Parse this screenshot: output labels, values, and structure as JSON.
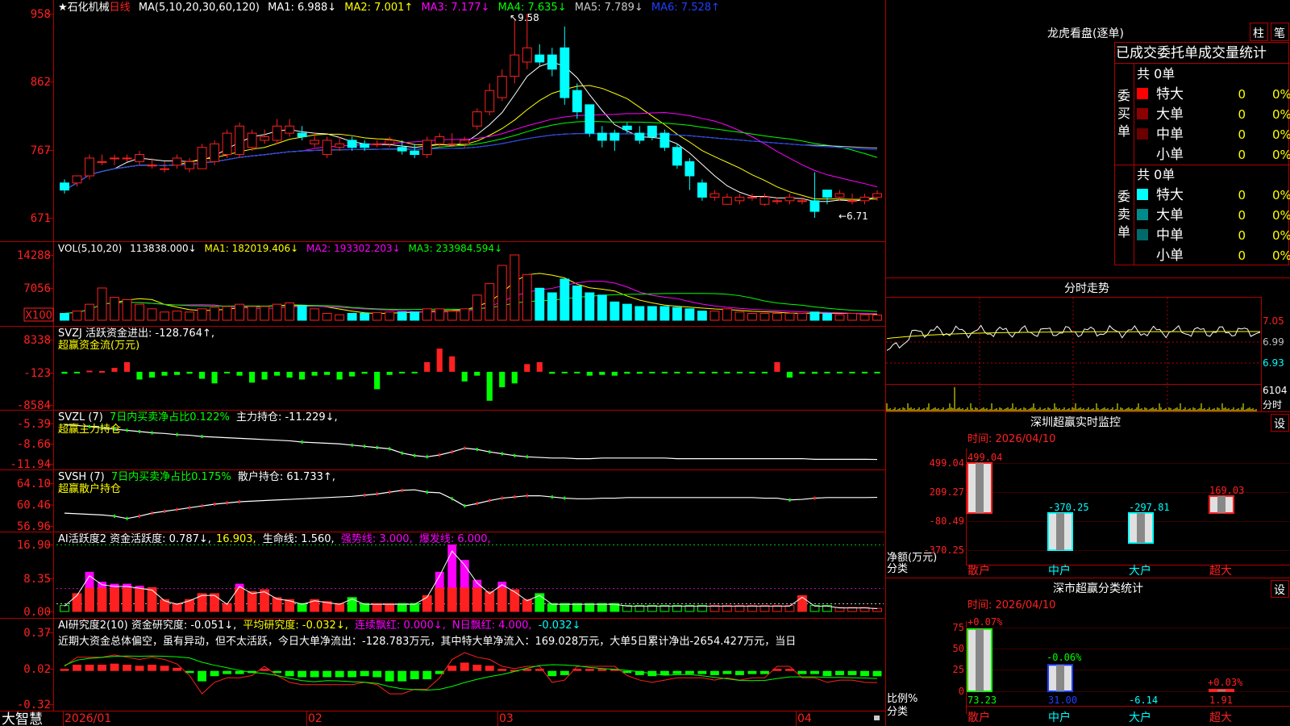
{
  "stock_title": "★石化机械",
  "period": "日线",
  "colors": {
    "up": "#ff2020",
    "down": "#00ffff",
    "grid": "#b00000",
    "ma1": "#ffffff",
    "ma2": "#ffff00",
    "ma3": "#ff00ff",
    "ma4": "#00ff00",
    "ma5": "#c8c8c8",
    "ma6": "#2040ff",
    "green": "#00ff00",
    "yellow": "#ffff00",
    "magenta": "#ff00ff"
  },
  "price_panel": {
    "header": [
      "MA(5,10,20,30,60,120)",
      "MA1: 6.988↓",
      "MA2: 7.001↑",
      "MA3: 7.177↓",
      "MA4: 7.635↓",
      "MA5: 7.789↓",
      "MA6: 7.528↑"
    ],
    "y_labels": [
      "958",
      "862",
      "767",
      "671"
    ],
    "high_note": "9.58",
    "low_note": "←6.71"
  },
  "vol_panel": {
    "header": [
      "VOL(5,10,20)",
      "113838.000↓",
      "MA1: 182019.406↓",
      "MA2: 193302.203↓",
      "MA3: 233984.594↓"
    ],
    "y_labels": [
      "14288",
      "7056",
      "X100"
    ]
  },
  "svzj_panel": {
    "header": "SVZJ  活跃资金进出: -128.764↑,",
    "subtitle": "超赢资金流(万元)",
    "y_labels": [
      "8338",
      "-123",
      "-8584"
    ]
  },
  "svzl_panel": {
    "header_a": "SVZL (7)",
    "header_b": "7日内买卖净占比0.122%",
    "header_c": "主力持仓: -11.229↓,",
    "subtitle": "超赢主力持仓",
    "y_labels": [
      "-5.39",
      "-8.66",
      "-11.94"
    ]
  },
  "svsh_panel": {
    "header_a": "SVSH (7)",
    "header_b": "7日内买卖净占比0.175%",
    "header_c": "散户持仓: 61.733↑,",
    "subtitle": "超赢散户持仓",
    "y_labels": [
      "64.10",
      "60.46",
      "56.96"
    ]
  },
  "ai1_panel": {
    "header": [
      "AI活跃度2 资金活跃度: 0.787↓,",
      "16.903,",
      "生命线: 1.560,",
      "强势线: 3.000,",
      "爆发线: 6.000,"
    ],
    "y_labels": [
      "16.90",
      "8.35",
      "0.00"
    ]
  },
  "ai2_panel": {
    "header": [
      "AI研究度2(10) 资金研究度: -0.051↓,",
      "平均研究度: -0.032↓,",
      "连续飘红: 0.000↓,",
      "N日飘红: 4.000,",
      "-0.032↓"
    ],
    "note": "近期大资金总体偏空，虽有异动，但不太活跃，今日大单净流出：-128.783万元，其中特大单净流入：169.028万元，大单5日累计净出-2654.427万元，当日",
    "y_labels": [
      "0.37",
      "0.02",
      "-0.32"
    ]
  },
  "x_axis": {
    "logo": "大智慧",
    "labels": [
      "2026/01",
      "02",
      "03",
      "04"
    ]
  },
  "chart_data": [
    {
      "type": "candlestick",
      "title": "石化机械 日线",
      "ylim": [
        6.71,
        9.58
      ],
      "x": [
        "01",
        "",
        "",
        "",
        "",
        "",
        "",
        "",
        "",
        "",
        "",
        "",
        "",
        "",
        "",
        "",
        "",
        "",
        "",
        "",
        "",
        "",
        "",
        "",
        "",
        "",
        "",
        "02",
        "",
        "",
        "",
        "",
        "",
        "",
        "",
        "",
        "",
        "",
        "",
        "",
        "03",
        "",
        "",
        "",
        "",
        "",
        "",
        "",
        "",
        "",
        "",
        "",
        "",
        "",
        "",
        "",
        "",
        "",
        "",
        "",
        "",
        "",
        "",
        "04",
        "",
        "",
        "",
        "",
        ""
      ],
      "open": [
        7.2,
        7.2,
        7.3,
        7.5,
        7.55,
        7.55,
        7.5,
        7.45,
        7.4,
        7.45,
        7.4,
        7.4,
        7.5,
        7.6,
        7.6,
        7.7,
        7.8,
        7.8,
        7.9,
        7.9,
        7.75,
        7.6,
        7.7,
        7.8,
        7.75,
        7.75,
        7.75,
        7.7,
        7.65,
        7.6,
        7.75,
        7.75,
        7.75,
        8.0,
        8.2,
        8.4,
        8.7,
        8.9,
        9.0,
        9.0,
        9.1,
        8.5,
        8.3,
        7.9,
        7.9,
        8.0,
        7.9,
        8.0,
        7.9,
        7.7,
        7.5,
        7.2,
        7.0,
        6.9,
        6.95,
        7.0,
        6.9,
        6.95,
        6.95,
        6.95,
        6.95,
        7.1,
        7.0,
        6.95,
        6.95,
        7.0
      ],
      "close": [
        7.1,
        7.3,
        7.55,
        7.5,
        7.55,
        7.55,
        7.6,
        7.45,
        7.4,
        7.55,
        7.5,
        7.7,
        7.75,
        7.9,
        8.0,
        7.9,
        7.85,
        8.0,
        8.0,
        7.85,
        7.8,
        7.8,
        7.75,
        7.7,
        7.7,
        7.75,
        7.8,
        7.65,
        7.6,
        7.8,
        7.85,
        7.75,
        7.8,
        8.2,
        8.5,
        8.7,
        9.0,
        9.1,
        8.9,
        8.8,
        8.4,
        8.2,
        7.9,
        7.8,
        7.8,
        7.95,
        7.8,
        7.85,
        7.7,
        7.45,
        7.3,
        7.0,
        7.05,
        7.0,
        7.0,
        7.0,
        7.0,
        6.95,
        7.0,
        6.95,
        6.8,
        7.0,
        7.05,
        6.95,
        7.0,
        7.05
      ],
      "high": [
        7.25,
        7.3,
        7.6,
        7.6,
        7.6,
        7.6,
        7.65,
        7.55,
        7.5,
        7.6,
        7.55,
        7.75,
        7.8,
        7.95,
        8.05,
        7.95,
        7.95,
        8.1,
        8.1,
        8.0,
        7.9,
        7.85,
        7.85,
        7.85,
        7.8,
        7.8,
        7.85,
        7.8,
        7.75,
        7.85,
        7.9,
        7.9,
        7.85,
        8.25,
        8.6,
        8.8,
        9.5,
        9.58,
        9.15,
        9.1,
        9.4,
        8.6,
        8.3,
        8.0,
        7.95,
        8.05,
        8.0,
        8.0,
        7.95,
        7.75,
        7.55,
        7.25,
        7.1,
        7.05,
        7.05,
        7.05,
        7.05,
        7.0,
        7.05,
        7.0,
        7.35,
        7.1,
        7.1,
        7.05,
        7.05,
        7.1
      ],
      "low": [
        7.05,
        7.15,
        7.25,
        7.45,
        7.45,
        7.5,
        7.45,
        7.4,
        7.35,
        7.4,
        7.35,
        7.4,
        7.45,
        7.55,
        7.55,
        7.65,
        7.75,
        7.75,
        7.85,
        7.8,
        7.7,
        7.55,
        7.65,
        7.65,
        7.65,
        7.7,
        7.7,
        7.6,
        7.55,
        7.55,
        7.7,
        7.7,
        7.7,
        7.95,
        8.15,
        8.35,
        8.6,
        8.8,
        8.85,
        8.7,
        8.3,
        8.1,
        7.85,
        7.7,
        7.65,
        7.9,
        7.75,
        7.8,
        7.65,
        7.4,
        7.1,
        6.95,
        6.95,
        6.9,
        6.9,
        6.95,
        6.88,
        6.9,
        6.9,
        6.9,
        6.71,
        6.9,
        6.95,
        6.9,
        6.9,
        6.95
      ]
    },
    {
      "type": "bar",
      "title": "VOL(5,10,20)",
      "unit": "X100",
      "ylim": [
        0,
        14288
      ],
      "values": [
        1500,
        2000,
        3500,
        7056,
        5000,
        4500,
        3500,
        2500,
        1800,
        2000,
        1800,
        2500,
        2800,
        3000,
        3500,
        3000,
        3000,
        3500,
        3800,
        3200,
        2500,
        1500,
        1200,
        1500,
        1500,
        1700,
        1800,
        1800,
        1800,
        2500,
        2500,
        2000,
        2500,
        5500,
        8000,
        12000,
        14288,
        10000,
        7000,
        6000,
        9000,
        7500,
        6000,
        5500,
        4000,
        3500,
        3000,
        3000,
        3000,
        2800,
        2500,
        2000,
        2000,
        2500,
        1800,
        1500,
        1500,
        1500,
        1500,
        1500,
        1800,
        1500,
        1200,
        1500,
        1200,
        1138
      ]
    },
    {
      "type": "bar",
      "title": "SVZJ 活跃资金进出",
      "ylim": [
        -8584,
        8338
      ],
      "values": [
        -500,
        -300,
        300,
        200,
        1000,
        2500,
        -2000,
        -1500,
        -1000,
        -800,
        -500,
        -1800,
        -3000,
        -200,
        -1000,
        -2800,
        -2000,
        -1000,
        -1500,
        -2000,
        -1000,
        -800,
        -2000,
        -1200,
        -500,
        -4500,
        -800,
        -300,
        -200,
        2500,
        6000,
        4000,
        -2500,
        -1000,
        -7500,
        -4000,
        -3000,
        2000,
        2500,
        -500,
        -300,
        -300,
        -1000,
        -800,
        -1000,
        -500,
        -500,
        -400,
        -400,
        -400,
        -300,
        -300,
        -300,
        -300,
        -300,
        -300,
        -300,
        2500,
        -1500,
        -500,
        -500,
        -400,
        -400,
        -300,
        -300,
        -129
      ]
    },
    {
      "type": "line",
      "title": "SVZL 主力持仓",
      "ylim": [
        -11.94,
        -5.39
      ],
      "values": [
        -5.6,
        -5.7,
        -5.9,
        -6.1,
        -6.3,
        -6.5,
        -6.7,
        -6.9,
        -7.0,
        -7.2,
        -7.3,
        -7.5,
        -7.6,
        -7.7,
        -7.8,
        -7.9,
        -8.0,
        -8.1,
        -8.2,
        -8.4,
        -8.5,
        -8.6,
        -8.7,
        -8.9,
        -9.1,
        -9.3,
        -9.5,
        -10.2,
        -10.6,
        -10.8,
        -10.5,
        -10.0,
        -9.4,
        -9.6,
        -10.0,
        -10.3,
        -10.6,
        -10.8,
        -10.9,
        -11.0,
        -11.0,
        -11.1,
        -11.1,
        -11.0,
        -11.0,
        -11.0,
        -11.0,
        -11.0,
        -11.0,
        -11.1,
        -11.1,
        -11.1,
        -11.1,
        -11.1,
        -11.1,
        -11.1,
        -11.1,
        -11.1,
        -11.1,
        -11.1,
        -11.2,
        -11.2,
        -11.2,
        -11.2,
        -11.2,
        -11.229
      ]
    },
    {
      "type": "line",
      "title": "SVSH 散户持仓",
      "ylim": [
        56.96,
        64.1
      ],
      "values": [
        59.1,
        59.0,
        58.9,
        58.8,
        58.6,
        58.2,
        58.6,
        59.1,
        59.4,
        59.7,
        60.0,
        60.3,
        60.6,
        60.8,
        61.0,
        61.1,
        61.2,
        61.3,
        61.4,
        61.5,
        61.6,
        61.7,
        61.8,
        61.9,
        62.1,
        62.3,
        62.6,
        62.9,
        63.0,
        62.6,
        62.5,
        61.5,
        60.3,
        60.7,
        61.2,
        61.6,
        61.8,
        62.0,
        62.0,
        61.8,
        61.6,
        61.5,
        61.5,
        61.6,
        61.6,
        61.7,
        61.7,
        61.7,
        61.7,
        61.7,
        61.7,
        61.7,
        61.7,
        61.7,
        61.7,
        61.7,
        61.6,
        61.6,
        61.3,
        61.4,
        61.6,
        61.7,
        61.7,
        61.7,
        61.7,
        61.733
      ]
    },
    {
      "type": "bar",
      "title": "AI活跃度2 资金活跃度",
      "ylim": [
        0,
        16.9
      ],
      "values": [
        1.5,
        4.5,
        10.0,
        7.5,
        7.0,
        7.0,
        6.5,
        6.0,
        3.0,
        2.0,
        3.0,
        4.5,
        4.5,
        2.0,
        7.0,
        5.0,
        5.5,
        3.5,
        3.0,
        2.0,
        3.0,
        2.5,
        2.0,
        3.5,
        2.0,
        2.0,
        2.0,
        2.0,
        2.0,
        4.0,
        10.0,
        16.9,
        13.0,
        8.0,
        5.0,
        7.5,
        5.5,
        3.0,
        4.5,
        2.0,
        2.0,
        2.0,
        2.0,
        2.0,
        2.0,
        1.5,
        1.5,
        1.5,
        1.5,
        1.5,
        1.5,
        1.5,
        1.5,
        1.5,
        1.5,
        1.5,
        1.5,
        1.5,
        1.5,
        4.0,
        1.5,
        1.5,
        1.0,
        1.0,
        1.0,
        0.787
      ]
    },
    {
      "type": "bar",
      "title": "AI研究度2 资金研究度",
      "ylim": [
        -0.32,
        0.37
      ],
      "values": [
        0.02,
        0.06,
        0.06,
        0.06,
        0.07,
        0.06,
        0.05,
        0.06,
        0.05,
        0.03,
        -0.02,
        -0.1,
        -0.05,
        -0.03,
        -0.03,
        -0.02,
        0.02,
        -0.02,
        -0.05,
        -0.06,
        -0.06,
        -0.06,
        -0.06,
        -0.06,
        -0.05,
        -0.06,
        -0.1,
        -0.1,
        -0.08,
        -0.08,
        -0.03,
        0.05,
        0.08,
        0.06,
        0.05,
        0.02,
        0.01,
        0.02,
        0.02,
        -0.05,
        -0.04,
        0.02,
        0.02,
        0.02,
        0.02,
        -0.02,
        -0.04,
        -0.05,
        -0.04,
        -0.03,
        -0.03,
        -0.03,
        -0.04,
        -0.03,
        -0.04,
        -0.03,
        -0.03,
        0.02,
        0.02,
        -0.03,
        -0.03,
        -0.05,
        -0.04,
        -0.04,
        -0.05,
        -0.051
      ]
    },
    {
      "type": "line",
      "title": "分时走势",
      "ylim": [
        6.93,
        7.05
      ],
      "y_labels": [
        "7.05",
        "6.99",
        "6.93",
        "6104",
        "分时"
      ]
    },
    {
      "type": "bar",
      "title": "深圳超赢实时监控",
      "categories": [
        "散户",
        "中户",
        "大户",
        "超大"
      ],
      "values": [
        499.04,
        -370.25,
        -297.81,
        169.03
      ],
      "ylim": [
        -370.25,
        499.04
      ]
    },
    {
      "type": "bar",
      "title": "深市超赢分类统计",
      "categories": [
        "散户",
        "中户",
        "大户",
        "超大"
      ],
      "values": [
        73.23,
        31.0,
        -6.14,
        1.91
      ],
      "changes": [
        "+0.07%",
        "-0.06%",
        "",
        "+0.03%"
      ],
      "ylim": [
        0,
        75
      ]
    }
  ],
  "right": {
    "lhkp_title": "龙虎看盘(逐单)",
    "btn_zhu": "柱",
    "btn_bi": "笔",
    "tbl_title": "已成交委托单成交量统计",
    "buy": {
      "total": "共 0单",
      "side": [
        "委",
        "买",
        "单"
      ],
      "rows": [
        {
          "name": "特大",
          "n": "0",
          "p": "0%",
          "c": "#ff0000"
        },
        {
          "name": "大单",
          "n": "0",
          "p": "0%",
          "c": "#8b0000"
        },
        {
          "name": "中单",
          "n": "0",
          "p": "0%",
          "c": "#6a0000"
        },
        {
          "name": "小单",
          "n": "0",
          "p": "0%",
          "c": ""
        }
      ]
    },
    "sell": {
      "total": "共 0单",
      "side": [
        "委",
        "卖",
        "单"
      ],
      "rows": [
        {
          "name": "特大",
          "n": "0",
          "p": "0%",
          "c": "#00ffff"
        },
        {
          "name": "大单",
          "n": "0",
          "p": "0%",
          "c": "#008b8b"
        },
        {
          "name": "中单",
          "n": "0",
          "p": "0%",
          "c": "#006a6a"
        },
        {
          "name": "小单",
          "n": "0",
          "p": "0%",
          "c": ""
        }
      ]
    },
    "fs_title": "分时走势",
    "monitor": {
      "title": "深圳超赢实时监控",
      "btn": "设",
      "time": "时间: 2026/04/10",
      "y_labels": [
        "499.04",
        "209.27",
        "-80.49",
        "-370.25"
      ],
      "axis_a": "净额(万元)",
      "axis_b": "分类",
      "cats": [
        "散户",
        "中户",
        "大户",
        "超大"
      ],
      "vals": [
        "499.04",
        "-370.25",
        "-297.81",
        "169.03"
      ]
    },
    "stat": {
      "title": "深市超赢分类统计",
      "btn": "设",
      "time": "时间: 2026/04/10",
      "y_labels": [
        "75",
        "50",
        "25",
        "0"
      ],
      "axis_a": "比例%",
      "axis_b": "分类",
      "cats": [
        "散户",
        "中户",
        "大户",
        "超大"
      ],
      "vals": [
        "73.23",
        "31.00",
        "-6.14",
        "1.91"
      ],
      "chg": [
        "+0.07%",
        "-0.06%",
        "+0.03%"
      ]
    }
  }
}
